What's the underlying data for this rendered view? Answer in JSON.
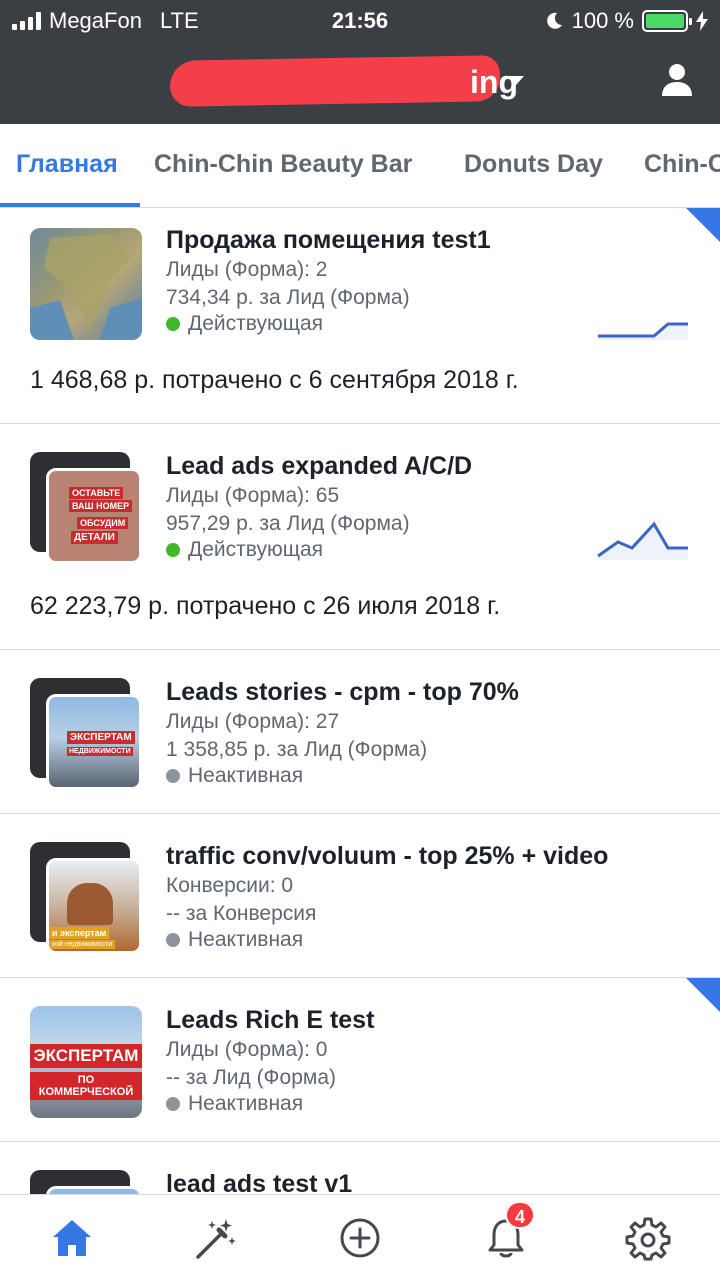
{
  "status_bar": {
    "carrier": "MegaFon",
    "network": "LTE",
    "time": "21:56",
    "battery": "100 %"
  },
  "header": {
    "account_name_visible": "ing",
    "profile_icon": "user-icon"
  },
  "tabs": [
    {
      "label": "Главная",
      "active": true
    },
    {
      "label": "Chin-Chin Beauty Bar",
      "active": false
    },
    {
      "label": "Donuts Day",
      "active": false
    },
    {
      "label": "Chin-C",
      "active": false
    }
  ],
  "ads": [
    {
      "title": "Продажа помещения test1",
      "line1": "Лиды (Форма): 2",
      "line2": "734,34 р. за Лид (Форма)",
      "status": "Действующая",
      "status_color": "#42b72a",
      "spent": "1 468,68 р. потрачено с 6 сентября 2018 г.",
      "has_new_corner": true
    },
    {
      "title": "Lead ads expanded A/C/D",
      "line1": "Лиды (Форма): 65",
      "line2": "957,29 р. за Лид (Форма)",
      "status": "Действующая",
      "status_color": "#42b72a",
      "spent": "62 223,79 р. потрачено с 26 июля 2018 г.",
      "thumb_text": [
        "ОСТАВЬТЕ",
        "ВАШ НОМЕР",
        "ОБСУДИМ",
        "ДЕТАЛИ"
      ]
    },
    {
      "title": "Leads stories - cpm - top 70%",
      "line1": "Лиды (Форма): 27",
      "line2": "1 358,85 р. за Лид (Форма)",
      "status": "Неактивная",
      "status_color": "#8d949e",
      "thumb_text": [
        "ЭКСПЕРТАМ",
        "НЕДВИЖИМОСТИ"
      ]
    },
    {
      "title": "traffic conv/voluum - top 25% + video",
      "line1": "Конверсии: 0",
      "line2": "-- за Конверсия",
      "status": "Неактивная",
      "status_color": "#8d949e",
      "thumb_text": [
        "и экспертам",
        "кой недвижимости"
      ]
    },
    {
      "title": "Leads Rich E test",
      "line1": "Лиды (Форма): 0",
      "line2": "-- за Лид (Форма)",
      "status": "Неактивная",
      "status_color": "#8d949e",
      "has_new_corner": true,
      "thumb_text": [
        "ЭКСПЕРТАМ",
        "ПО КОММЕРЧЕСКОЙ"
      ]
    },
    {
      "title": "lead ads test v1"
    }
  ],
  "bottom_nav": {
    "items": [
      "home-icon",
      "magic-wand-icon",
      "add-circle-icon",
      "bell-icon",
      "settings-gear-icon"
    ],
    "notifications_count": "4",
    "accent_color": "#3578e5"
  }
}
